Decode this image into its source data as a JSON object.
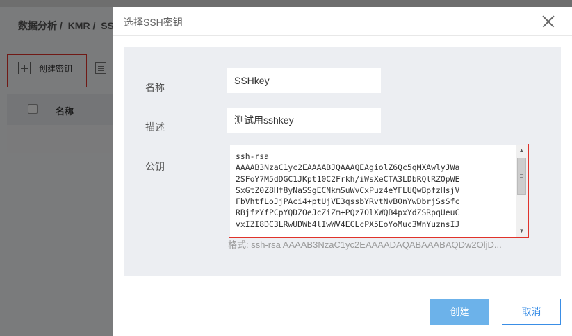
{
  "background": {
    "breadcrumb": [
      "数据分析 /",
      "KMR /",
      "SS"
    ],
    "toolbar": {
      "create_label": "创建密钥"
    },
    "table": {
      "header_name": "名称"
    }
  },
  "modal": {
    "title": "选择SSH密钥",
    "fields": {
      "name": {
        "label": "名称",
        "value": "SSHkey"
      },
      "description": {
        "label": "描述",
        "value": "测试用sshkey"
      },
      "public_key": {
        "label": "公钥",
        "value": "ssh-rsa\nAAAAB3NzaC1yc2EAAAABJQAAAQEAgiolZ6Qc5qMXAwlyJWa\n2SFoY7M5dDGC1JKpt10C2Frkh/iWsXeCTA3LDbRQlRZOpWE\nSxGtZ0Z8Hf8yNaSSgECNkmSuWvCxPuz4eYFLUQwBpfzHsjV\nFbVhtfLoJjPAci4+ptUjVE3qssbYRvtNvB0nYwDbrjSsSfc\nRBjfzYfPCpYQDZOeJcZiZm+PQz7OlXWQB4pxYdZSRpqUeuC\nvxIZI8DC3LRwUDWb4lIwWV4ECLcPX5EoYoMuc3WnYuznsIJ",
        "format_hint": "格式: ssh-rsa AAAAB3NzaC1yc2EAAAADAQABAAABAQDw2OljD..."
      }
    },
    "buttons": {
      "create": "创建",
      "cancel": "取消"
    }
  },
  "colors": {
    "primary_button": "#6cb2ea",
    "cancel_border": "#3a8ee6",
    "highlight_border": "#e0332b",
    "panel_bg": "#eceef2"
  }
}
